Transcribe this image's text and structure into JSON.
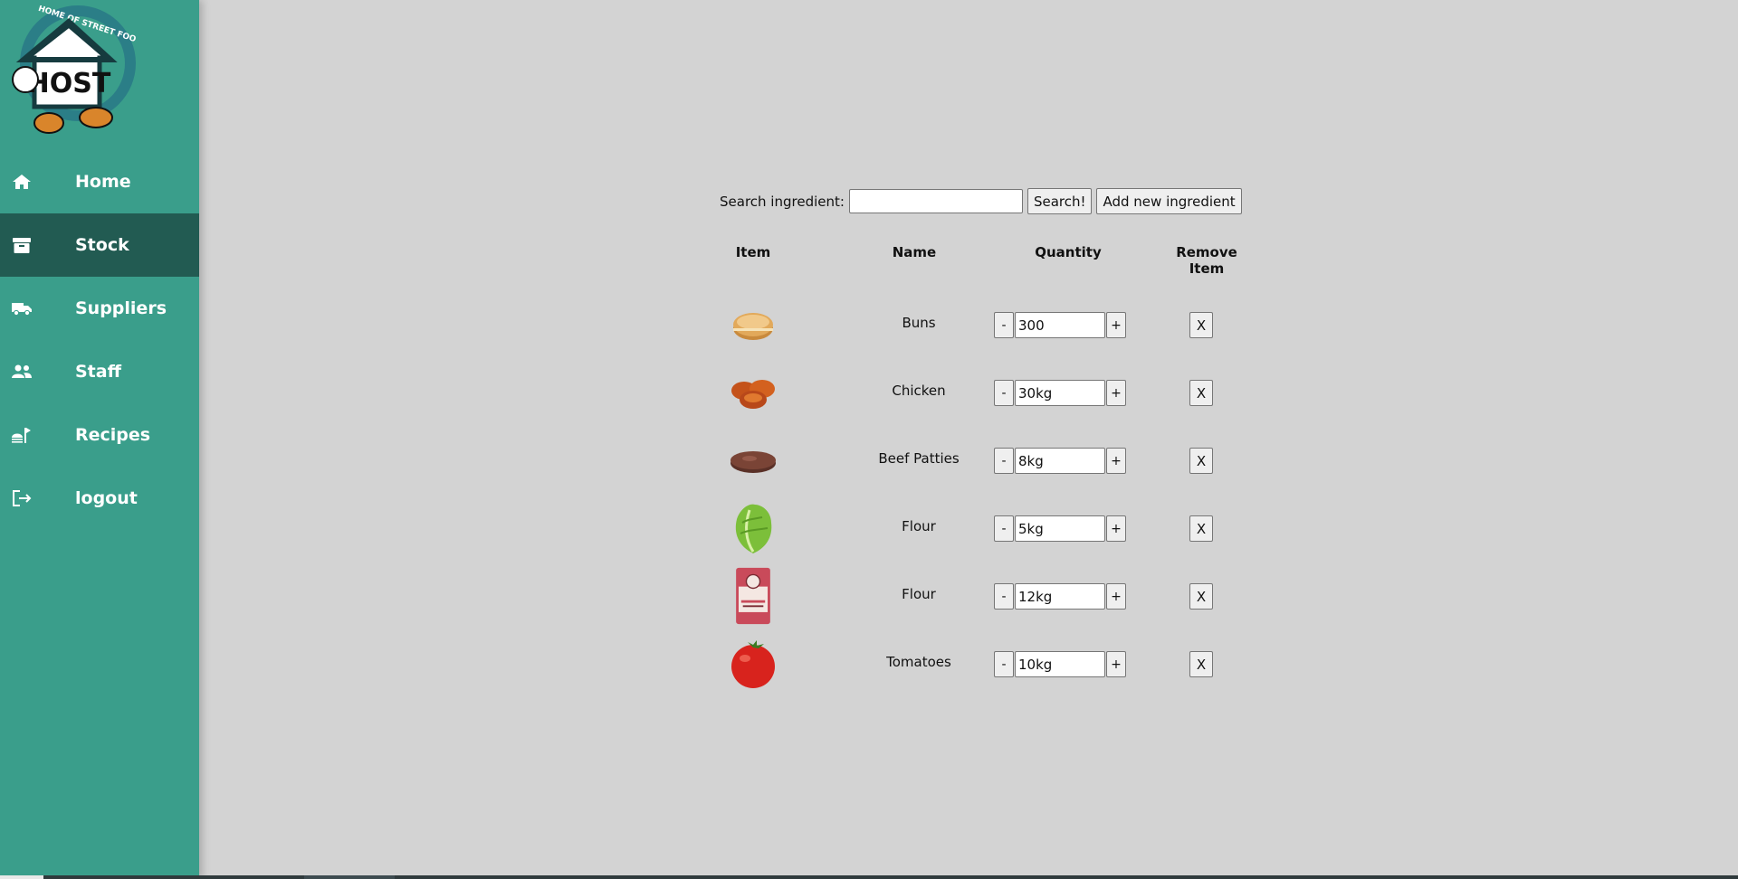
{
  "app": {
    "logo_alt": "HOST Home of Street Food",
    "logo_text": "HOME OF STREET FOOD",
    "logo_letters": "HOST"
  },
  "colors": {
    "sidebar": "#3a9e8b",
    "sidebar_active": "#225b52",
    "background": "#d3d3d3"
  },
  "sidebar": {
    "items": [
      {
        "label": "Home",
        "icon": "home-icon",
        "active": false
      },
      {
        "label": "Stock",
        "icon": "archive-box-icon",
        "active": true
      },
      {
        "label": "Suppliers",
        "icon": "truck-icon",
        "active": false
      },
      {
        "label": "Staff",
        "icon": "people-icon",
        "active": false
      },
      {
        "label": "Recipes",
        "icon": "food-tray-icon",
        "active": false
      },
      {
        "label": "logout",
        "icon": "logout-icon",
        "active": false
      }
    ]
  },
  "search": {
    "label": "Search ingredient:",
    "value": "",
    "search_button": "Search!",
    "add_button": "Add new ingredient"
  },
  "table": {
    "headers": {
      "item": "Item",
      "name": "Name",
      "quantity": "Quantity",
      "remove": "Remove Item"
    },
    "rows": [
      {
        "image": "bun-image",
        "name": "Buns",
        "quantity": "300"
      },
      {
        "image": "chicken-image",
        "name": "Chicken",
        "quantity": "30kg"
      },
      {
        "image": "beef-patty-image",
        "name": "Beef Patties",
        "quantity": "8kg"
      },
      {
        "image": "lettuce-image",
        "name": "Flour",
        "quantity": "5kg"
      },
      {
        "image": "flour-bag-image",
        "name": "Flour",
        "quantity": "12kg"
      },
      {
        "image": "tomato-image",
        "name": "Tomatoes",
        "quantity": "10kg"
      }
    ],
    "minus_label": "-",
    "plus_label": "+",
    "remove_label": "X"
  }
}
